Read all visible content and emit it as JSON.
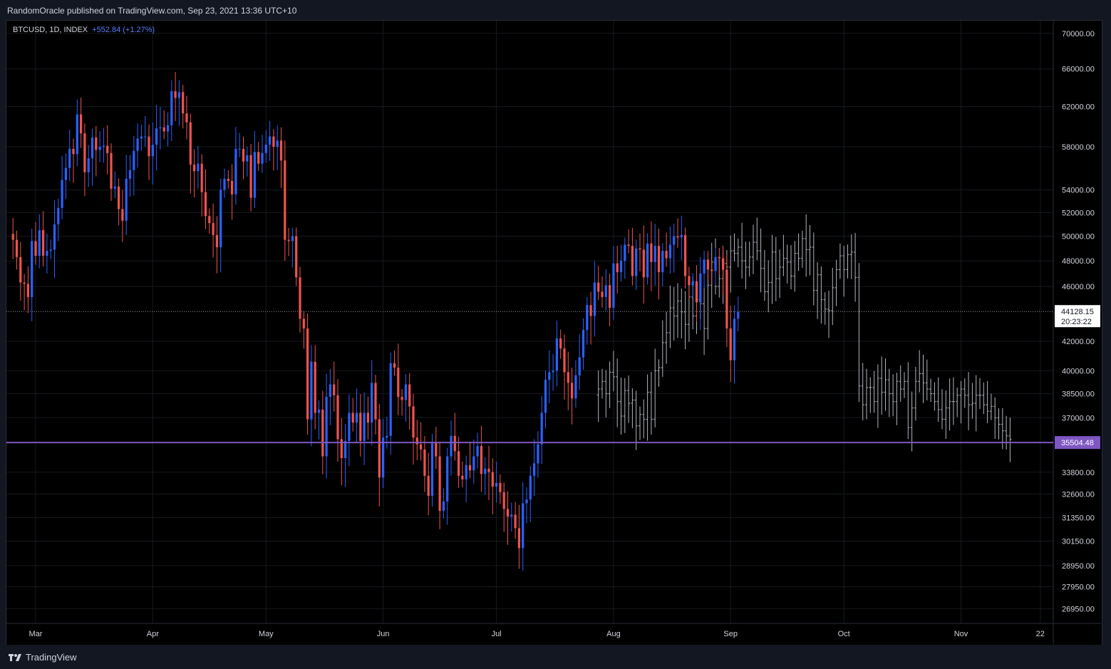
{
  "header": {
    "published_text": "RandomOracle published on TradingView.com, Sep 23, 2021 13:36 UTC+10"
  },
  "legend": {
    "symbol": "BTCUSD, 1D, INDEX",
    "change": "+552.84 (+1.27%)"
  },
  "footer": {
    "brand": "TradingView"
  },
  "colors": {
    "up": "#2962ff",
    "down": "#f05350",
    "projection": "#b2b5be",
    "support": "#7e57c2",
    "background": "#000000"
  },
  "chart_data": {
    "type": "candlestick",
    "symbol": "BTCUSD",
    "interval": "1D",
    "y_scale": "log",
    "ylim": [
      26300,
      71500
    ],
    "y_ticks": [
      {
        "value": 70000,
        "label": "70000.00"
      },
      {
        "value": 66000,
        "label": "66000.00"
      },
      {
        "value": 62000,
        "label": "62000.00"
      },
      {
        "value": 58000,
        "label": "58000.00"
      },
      {
        "value": 54000,
        "label": "54000.00"
      },
      {
        "value": 52000,
        "label": "52000.00"
      },
      {
        "value": 50000,
        "label": "50000.00"
      },
      {
        "value": 48000,
        "label": "48000.00"
      },
      {
        "value": 46000,
        "label": "46000.00"
      },
      {
        "value": 42000,
        "label": "42000.00"
      },
      {
        "value": 40000,
        "label": "40000.00"
      },
      {
        "value": 38500,
        "label": "38500.00"
      },
      {
        "value": 37000,
        "label": "37000.00"
      },
      {
        "value": 33800,
        "label": "33800.00"
      },
      {
        "value": 32600,
        "label": "32600.00"
      },
      {
        "value": 31350,
        "label": "31350.00"
      },
      {
        "value": 30150,
        "label": "30150.00"
      },
      {
        "value": 28950,
        "label": "28950.00"
      },
      {
        "value": 27950,
        "label": "27950.00"
      },
      {
        "value": 26950,
        "label": "26950.00"
      }
    ],
    "x_ticks": [
      {
        "date": "2021-03-01",
        "label": "Mar"
      },
      {
        "date": "2021-04-01",
        "label": "Apr"
      },
      {
        "date": "2021-05-01",
        "label": "May"
      },
      {
        "date": "2021-06-01",
        "label": "Jun"
      },
      {
        "date": "2021-07-01",
        "label": "Jul"
      },
      {
        "date": "2021-08-01",
        "label": "Aug"
      },
      {
        "date": "2021-09-01",
        "label": "Sep"
      },
      {
        "date": "2021-10-01",
        "label": "Oct"
      },
      {
        "date": "2021-11-01",
        "label": "Nov"
      },
      {
        "date": "2021-11-22",
        "label": "22"
      }
    ],
    "last_price": {
      "value": 44128.15,
      "label": "44128.15",
      "countdown": "20:23:22"
    },
    "support_line": {
      "value": 35504.48,
      "label": "35504.48"
    },
    "series": [
      {
        "name": "BTCUSD",
        "style": "candles",
        "start": "2021-02-23",
        "close": [
          49700,
          48300,
          46300,
          46200,
          45200,
          49600,
          48400,
          50500,
          48400,
          48800,
          48900,
          51000,
          52400,
          54900,
          56000,
          57800,
          57300,
          61200,
          59300,
          55600,
          56900,
          58900,
          57700,
          58000,
          58100,
          57400,
          54100,
          54300,
          52300,
          51300,
          55000,
          55800,
          57600,
          58800,
          59000,
          59000,
          57100,
          58200,
          59800,
          59900,
          59500,
          60100,
          63600,
          62900,
          63500,
          61300,
          60400,
          56300,
          55700,
          56400,
          53800,
          51700,
          51100,
          50100,
          49100,
          54000,
          55000,
          54800,
          53600,
          57800,
          57800,
          56600,
          57200,
          53300,
          57500,
          56400,
          57400,
          58200,
          59000,
          58000,
          58600,
          56700,
          49700,
          49600,
          50000,
          46700,
          43600,
          42900,
          36900,
          40600,
          37300,
          37500,
          34700,
          38300,
          39100,
          38400,
          35700,
          34600,
          35600,
          37300,
          36700,
          37300,
          35600,
          37300,
          36700,
          39200,
          36900,
          33500,
          35800,
          35900,
          40500,
          40200,
          38300,
          38100,
          39100,
          37700,
          35800,
          35400,
          35100,
          33600,
          32500,
          35500,
          34700,
          31700,
          32200,
          34700,
          35900,
          35000,
          33600,
          33400,
          34200,
          33900,
          34700,
          35300,
          33700,
          34000,
          33800,
          33000,
          33200,
          32700,
          31800,
          31400,
          31500,
          30800,
          29800,
          32100,
          32300,
          33600,
          34300,
          35400,
          37300,
          39400,
          39900,
          40000,
          42200,
          41500,
          39900,
          39200,
          38200,
          39700,
          40900,
          42800,
          44600,
          43800,
          46300,
          45600,
          45200,
          46100,
          44400,
          47800,
          47100,
          48000,
          49300,
          49200,
          46800,
          49000,
          48900,
          46700,
          49400,
          47900,
          49200,
          47100,
          48800,
          48200,
          49300,
          50000,
          49900,
          50100,
          46800,
          46100,
          46400,
          44800,
          47000,
          48100,
          47300,
          47200,
          48300,
          48200,
          47300,
          42900,
          40700,
          43600,
          44100
        ]
      },
      {
        "name": "projection",
        "style": "bars",
        "start": "2021-07-28",
        "close": [
          38800,
          39300,
          38500,
          39900,
          39600,
          38000,
          37100,
          38700,
          37900,
          38100,
          36500,
          37200,
          36900,
          38600,
          36900,
          40000,
          40200,
          41900,
          42600,
          44400,
          43800,
          44900,
          44100,
          43200,
          45200,
          43800,
          45000,
          44700,
          42900,
          46100,
          47900,
          46000,
          46600,
          47800,
          47500,
          48800,
          48600,
          49100,
          48000,
          47500,
          48300,
          49500,
          48800,
          47400,
          45600,
          46300,
          48700,
          46600,
          47500,
          48200,
          47900,
          46800,
          48600,
          48200,
          49800,
          48900,
          49100,
          45700,
          46900,
          45000,
          44300,
          44200,
          45900,
          47300,
          48400,
          47300,
          48500,
          48700,
          46700,
          39000,
          37800,
          38900,
          38900,
          38000,
          39500,
          38600,
          39400,
          38500,
          38000,
          39300,
          38800,
          39300,
          36400,
          37600,
          39300,
          39800,
          39200,
          38800,
          38500,
          38000,
          37500,
          36900,
          37600,
          38000,
          38000,
          38400,
          38800,
          38400,
          37800,
          37900,
          38400,
          38400,
          37800,
          37400,
          37700,
          37000,
          36600,
          36200,
          35900,
          35700
        ]
      }
    ]
  }
}
